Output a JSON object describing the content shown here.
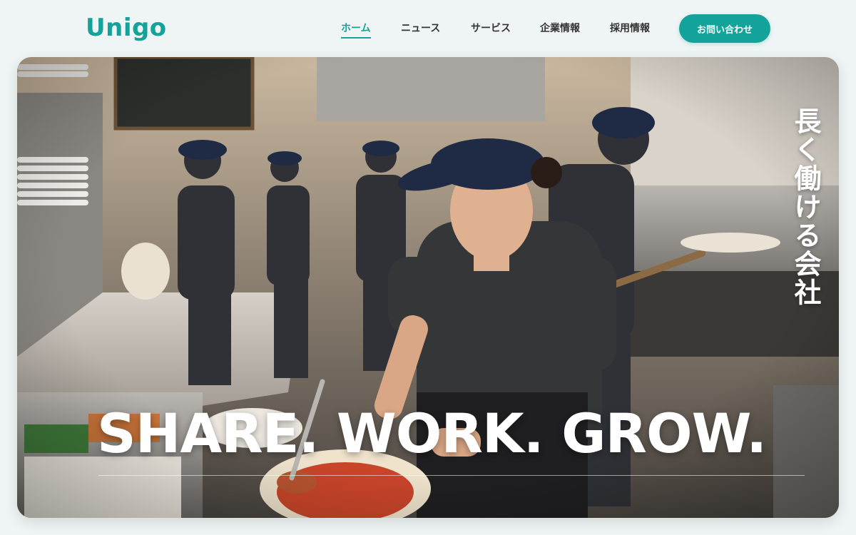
{
  "brand": {
    "logo_text": "Unigo",
    "accent_color": "#14a39a"
  },
  "nav": {
    "items": [
      {
        "label": "ホーム",
        "active": true
      },
      {
        "label": "ニュース",
        "active": false
      },
      {
        "label": "サービス",
        "active": false
      },
      {
        "label": "企業情報",
        "active": false
      },
      {
        "label": "採用情報",
        "active": false
      }
    ]
  },
  "header": {
    "contact_label": "お問い合わせ"
  },
  "hero": {
    "vertical_copy": "長く働ける会社",
    "tagline": "SHARE. WORK. GROW.",
    "image": "pizza-kitchen-staff-photo"
  }
}
